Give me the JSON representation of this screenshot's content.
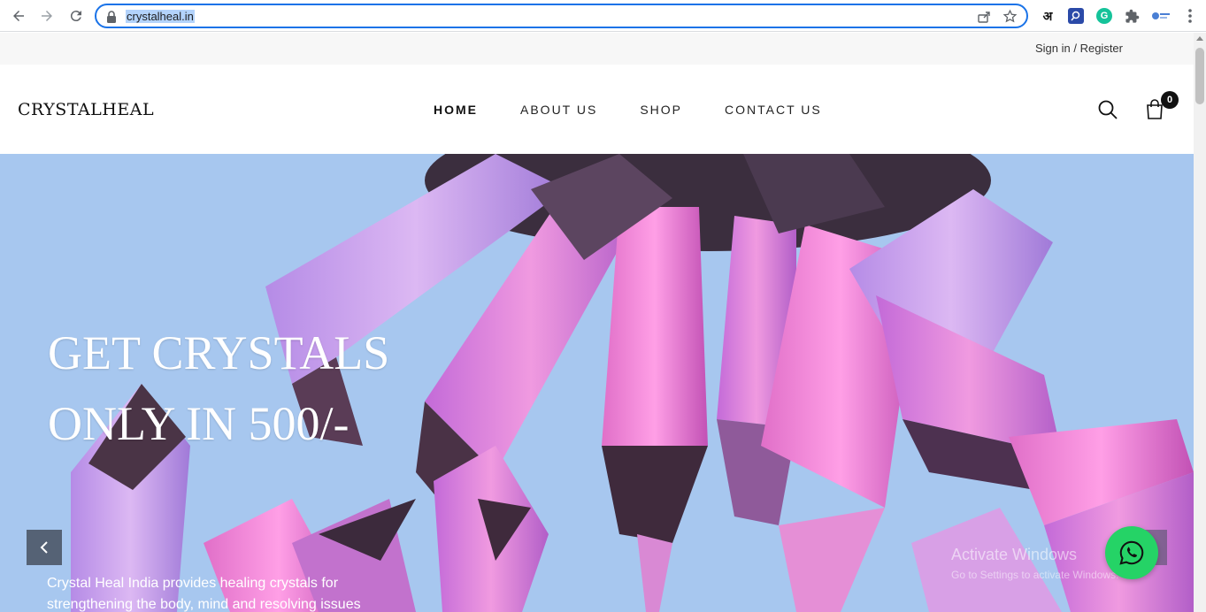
{
  "browser": {
    "url": "crystalheal.in",
    "extensions": {
      "hindi": "अ",
      "grammarly": "G"
    }
  },
  "topbar": {
    "signin": "Sign in / Register"
  },
  "header": {
    "logo": "CRYSTALHEAL",
    "menu": [
      {
        "label": "HOME"
      },
      {
        "label": "ABOUT US"
      },
      {
        "label": "SHOP"
      },
      {
        "label": "CONTACT US"
      }
    ],
    "cart_count": "0"
  },
  "hero": {
    "title_line1": "GET CRYSTALS",
    "title_line2": "ONLY IN 500/-",
    "description": "Crystal Heal India provides healing crystals for strengthening the body, mind and resolving issues"
  },
  "watermark": {
    "line1": "Activate Windows",
    "line2": "Go to Settings to activate Windows."
  },
  "colors": {
    "hero_bg": "#a7c7ef",
    "crystal_pink": "#e07bd0",
    "whatsapp_green": "#25d366",
    "omnibox_focus": "#1a73e8"
  }
}
